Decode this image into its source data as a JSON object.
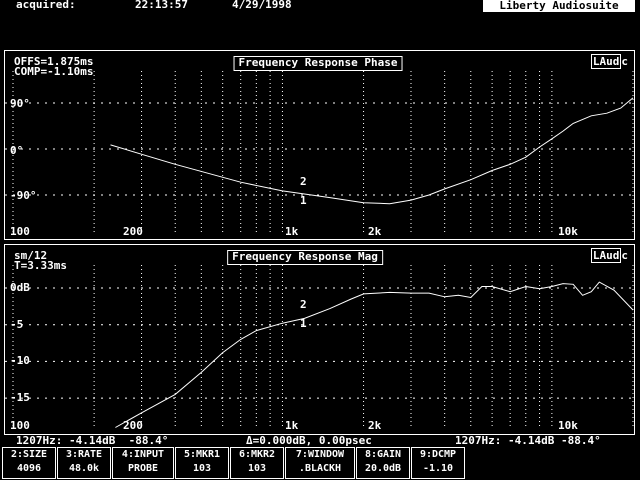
{
  "header": {
    "label": "acquired:",
    "time": "22:13:57",
    "date": "4/29/1998",
    "app_title": "Liberty Audiosuite"
  },
  "phase_panel": {
    "info_line1": "OFFS=1.875ms",
    "info_line2": "COMP=-1.10ms",
    "title": "Frequency Response Phase",
    "badge": "LAud",
    "badge_sub": "c",
    "y_labels": [
      "90°",
      "0°",
      "-90°"
    ],
    "x_labels": [
      "100",
      "200",
      "1k",
      "2k",
      "10k"
    ]
  },
  "mag_panel": {
    "info_line1": "sm/12",
    "info_line2": "T=3.33ms",
    "title": "Frequency Response Mag",
    "badge": "LAud",
    "badge_sub": "c",
    "y_labels": [
      "0dB",
      "-5",
      "-10",
      "-15"
    ],
    "x_labels": [
      "100",
      "200",
      "1k",
      "2k",
      "10k"
    ]
  },
  "markers": {
    "m1": "1",
    "m2": "2"
  },
  "status_bar": {
    "left": "1207Hz: -4.14dB  -88.4°",
    "center": "Δ=0.000dB, 0.00psec",
    "right": "1207Hz: -4.14dB -88.4°"
  },
  "function_keys": [
    {
      "label": "2:SIZE",
      "value": "4096"
    },
    {
      "label": "3:RATE",
      "value": "48.0k"
    },
    {
      "label": "4:INPUT",
      "value": "PROBE"
    },
    {
      "label": "5:MKR1",
      "value": "103"
    },
    {
      "label": "6:MKR2",
      "value": "103"
    },
    {
      "label": "7:WINDOW",
      "value": ".BLACKH"
    },
    {
      "label": "8:GAIN",
      "value": "20.0dB"
    },
    {
      "label": "9:DCMP",
      "value": "-1.10"
    }
  ],
  "phase_curve": {
    "freq_hz": [
      230,
      400,
      700,
      1000,
      1207,
      1500,
      2000,
      2500,
      3000,
      3500,
      4000,
      5000,
      6000,
      7000,
      8000,
      9000,
      10000,
      11000,
      12000,
      14000,
      16000,
      18000,
      20000
    ],
    "phase_deg": [
      8,
      -30,
      -65,
      -82,
      -88,
      -95,
      -105,
      -107,
      -100,
      -90,
      -78,
      -60,
      -42,
      -30,
      -16,
      4,
      20,
      35,
      50,
      65,
      70,
      80,
      100
    ]
  },
  "mag_curve": {
    "freq_hz": [
      240,
      300,
      400,
      500,
      600,
      700,
      800,
      1000,
      1207,
      1500,
      1800,
      2000,
      2500,
      3000,
      3500,
      4000,
      4500,
      5000,
      5500,
      6000,
      7000,
      8000,
      9000,
      10000,
      11000,
      12000,
      13000,
      14000,
      15000,
      17000,
      20000
    ],
    "mag_db": [
      -19,
      -17,
      -14.5,
      -11.5,
      -8.8,
      -7,
      -5.8,
      -4.8,
      -4.14,
      -2.8,
      -1.5,
      -0.8,
      -0.6,
      -0.7,
      -0.7,
      -1.2,
      -1.0,
      -1.3,
      0.2,
      0.2,
      -0.5,
      0.2,
      -0.1,
      0.2,
      0.6,
      0.5,
      -1.0,
      -0.5,
      0.8,
      -0.3,
      -3.0
    ]
  }
}
